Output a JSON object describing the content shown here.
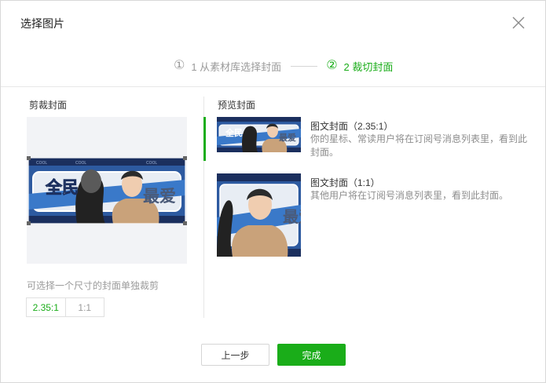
{
  "dialog": {
    "title": "选择图片",
    "close_icon": "close-icon"
  },
  "steps": [
    {
      "num": "①",
      "label": "1 从素材库选择封面",
      "state": "done"
    },
    {
      "num": "②",
      "label": "2 裁切封面",
      "state": "active"
    }
  ],
  "crop": {
    "section_label": "剪裁封面",
    "hint": "可选择一个尺寸的封面单独裁剪",
    "ratios": [
      "2.35:1",
      "1:1"
    ],
    "selected_ratio": "2.35:1"
  },
  "preview": {
    "section_label": "预览封面",
    "items": [
      {
        "title": "图文封面（2.35:1）",
        "desc": "你的星标、常读用户将在订阅号消息列表里，看到此封面。"
      },
      {
        "title": "图文封面（1:1）",
        "desc": "其他用户将在订阅号消息列表里，看到此封面。"
      }
    ]
  },
  "cover_text": {
    "left": "全民",
    "right": "最爱",
    "tag": "COOL"
  },
  "footer": {
    "prev_label": "上一步",
    "done_label": "完成"
  },
  "colors": {
    "accent": "#1aad19",
    "banner_blue": "#2d5aa0",
    "banner_dark": "#1b2f5e"
  }
}
